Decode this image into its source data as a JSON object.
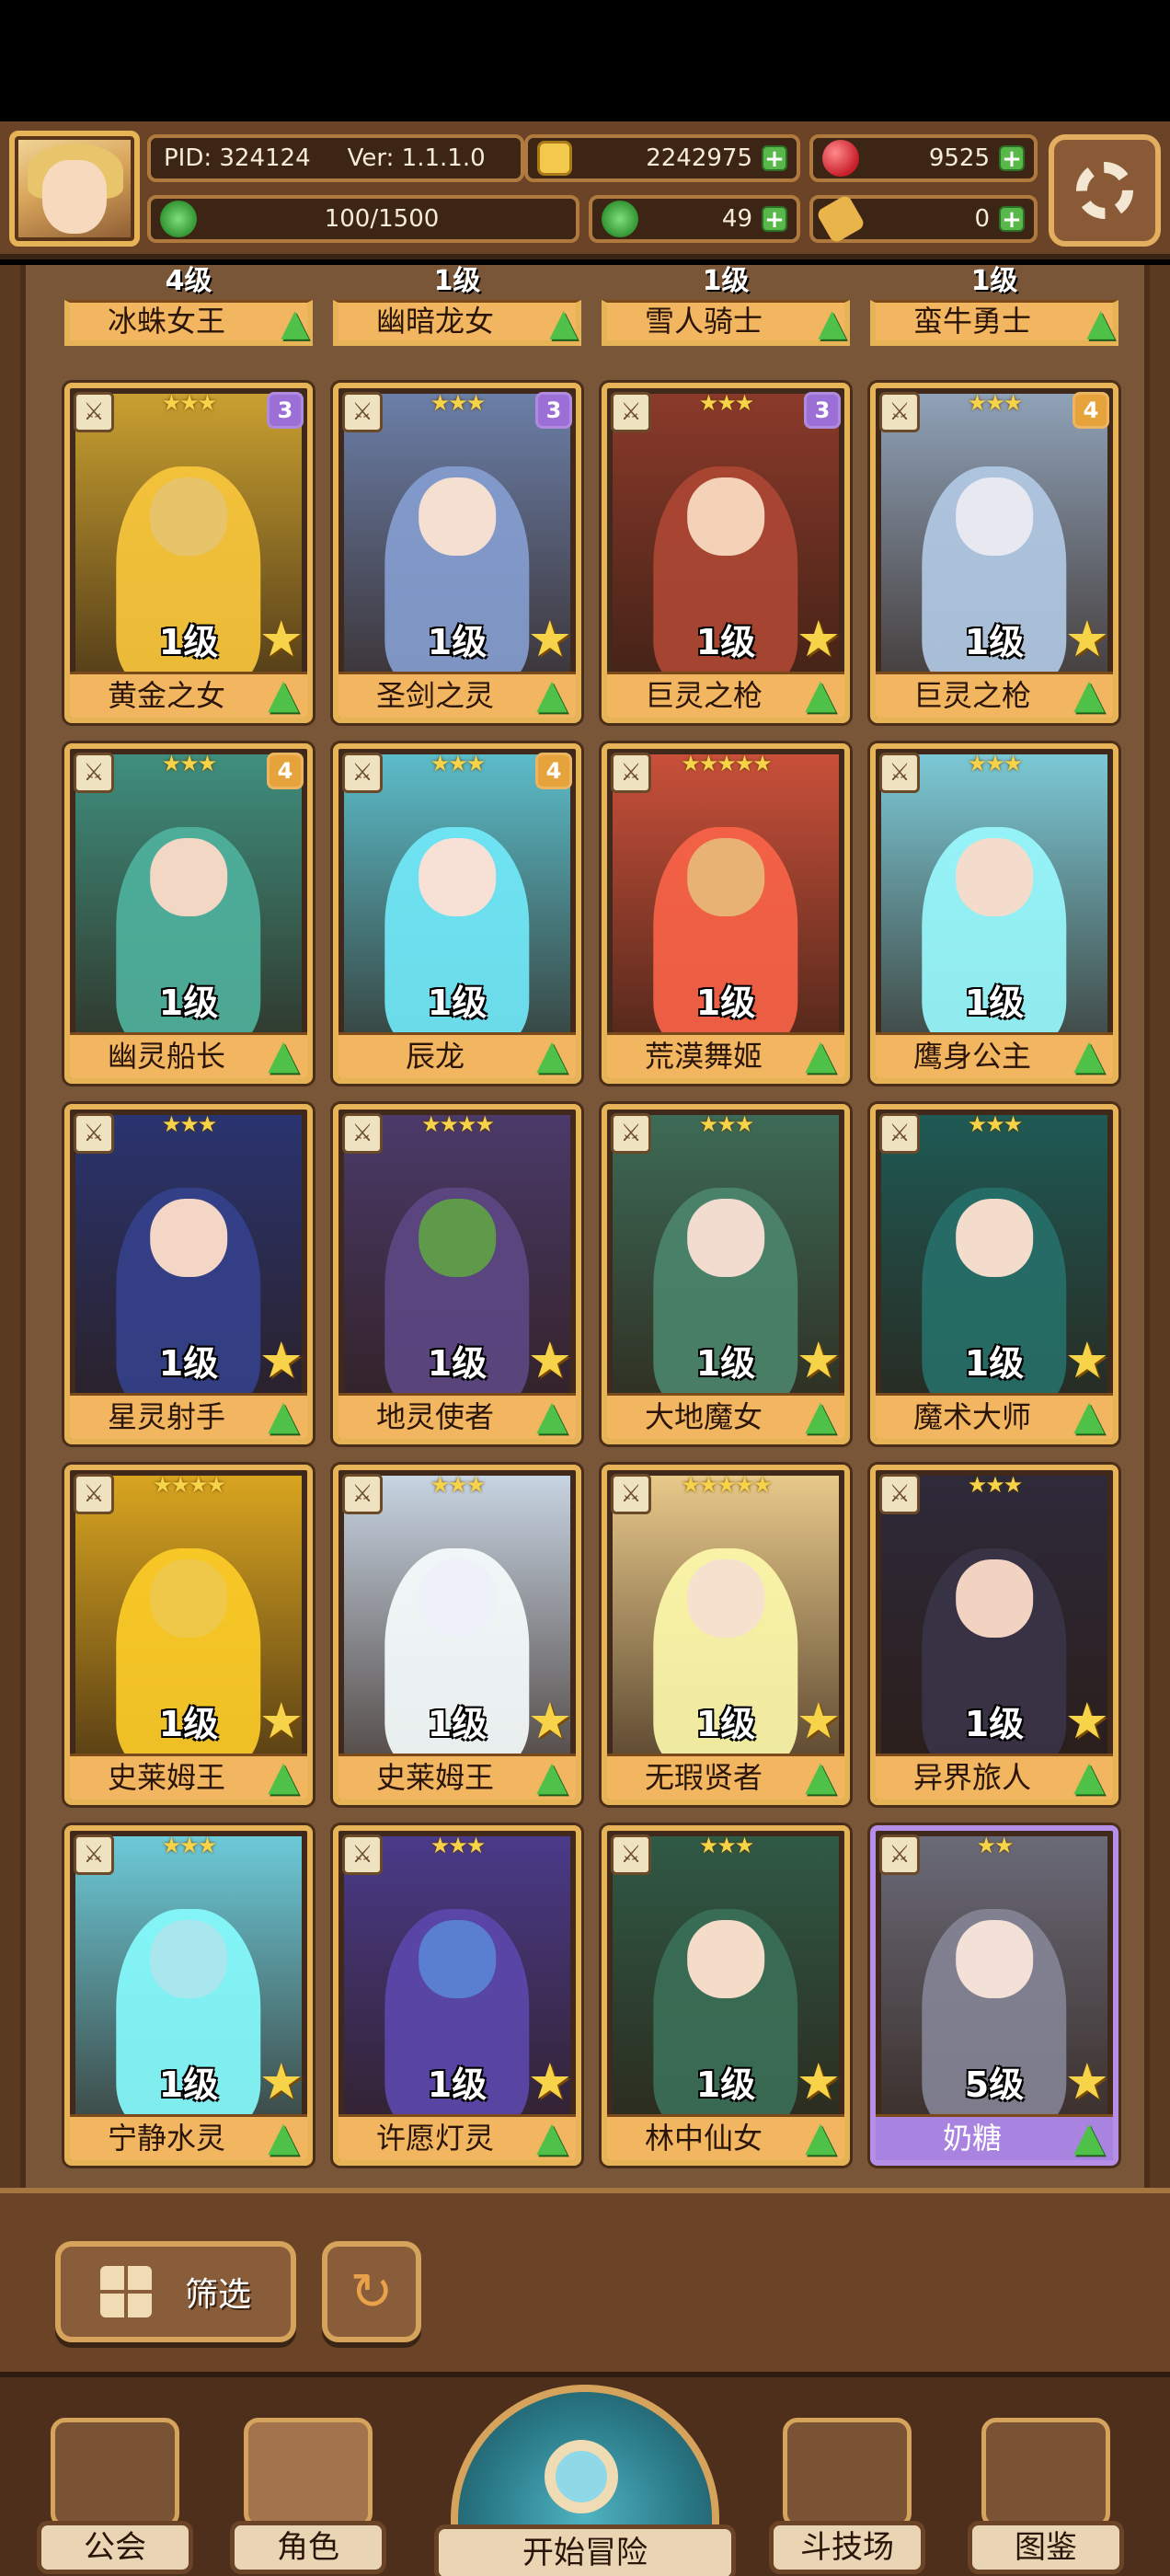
{
  "hud": {
    "pid": "PID: 324124",
    "version": "Ver: 1.1.1.0",
    "gold": "2242975",
    "gems": "9525",
    "stamina": "100/1500",
    "clover": "49",
    "scroll": "0"
  },
  "partial_row": [
    {
      "level": "4级",
      "name": "冰蛛女王"
    },
    {
      "level": "1级",
      "name": "幽暗龙女"
    },
    {
      "level": "1级",
      "name": "雪人骑士"
    },
    {
      "level": "1级",
      "name": "蛮牛勇士"
    }
  ],
  "cards": [
    {
      "name": "黄金之女",
      "level": "1级",
      "stars": "★★★",
      "badge": "3",
      "badge_color": "#9b6fd6",
      "frame": "gold",
      "art": "#c9a030",
      "face": "#e7c36a"
    },
    {
      "name": "圣剑之灵",
      "level": "1级",
      "stars": "★★★",
      "badge": "3",
      "badge_color": "#9b6fd6",
      "frame": "gold",
      "art": "#6b7fa8",
      "face": "#f4dfd1"
    },
    {
      "name": "巨灵之枪",
      "level": "1级",
      "stars": "★★★",
      "badge": "3",
      "badge_color": "#9b6fd6",
      "frame": "gold",
      "art": "#8b3a2a",
      "face": "#f3d2b8"
    },
    {
      "name": "巨灵之枪",
      "level": "1级",
      "stars": "★★★",
      "badge": "4",
      "badge_color": "#e6a33b",
      "frame": "gold",
      "art": "#8fa2b8",
      "face": "#e8e8f0"
    },
    {
      "name": "幽灵船长",
      "level": "1级",
      "stars": "★★★",
      "badge": "4",
      "badge_color": "#e6a33b",
      "frame": "gold",
      "art": "#3f8f7e",
      "face": "#f2d7c5"
    },
    {
      "name": "辰龙",
      "level": "1级",
      "stars": "★★★",
      "badge": "4",
      "badge_color": "#e6a33b",
      "frame": "gold",
      "art": "#5bbcc9",
      "face": "#f7e0d6"
    },
    {
      "name": "荒漠舞姬",
      "level": "1级",
      "stars": "★★★★★",
      "badge": "",
      "badge_color": "",
      "frame": "gold",
      "art": "#c9503a",
      "face": "#e8b274"
    },
    {
      "name": "鹰身公主",
      "level": "1级",
      "stars": "★★★",
      "badge": "",
      "badge_color": "",
      "frame": "gold",
      "art": "#7bc9d6",
      "face": "#f4dccd"
    },
    {
      "name": "星灵射手",
      "level": "1级",
      "stars": "★★★",
      "badge": "",
      "badge_color": "",
      "frame": "gold",
      "art": "#2a3470",
      "face": "#f3d6c6"
    },
    {
      "name": "地灵使者",
      "level": "1级",
      "stars": "★★★★",
      "badge": "",
      "badge_color": "",
      "frame": "gold",
      "art": "#4b3a6a",
      "face": "#5e9a4a"
    },
    {
      "name": "大地魔女",
      "level": "1级",
      "stars": "★★★",
      "badge": "",
      "badge_color": "",
      "frame": "gold",
      "art": "#3d6b57",
      "face": "#f2dcd0"
    },
    {
      "name": "魔术大师",
      "level": "1级",
      "stars": "★★★",
      "badge": "",
      "badge_color": "",
      "frame": "gold",
      "art": "#1f5a55",
      "face": "#f4dccd"
    },
    {
      "name": "史莱姆王",
      "level": "1级",
      "stars": "★★★★",
      "badge": "",
      "badge_color": "",
      "frame": "gold",
      "art": "#d9a520",
      "face": "#efc84a"
    },
    {
      "name": "史莱姆王",
      "level": "1级",
      "stars": "★★★",
      "badge": "",
      "badge_color": "",
      "frame": "gold",
      "art": "#c7d4e2",
      "face": "#eef2f8"
    },
    {
      "name": "无瑕贤者",
      "level": "1级",
      "stars": "★★★★★",
      "badge": "",
      "badge_color": "",
      "frame": "gold",
      "art": "#e8c98a",
      "face": "#f6e1cf"
    },
    {
      "name": "异界旅人",
      "level": "1级",
      "stars": "★★★",
      "badge": "",
      "badge_color": "",
      "frame": "gold",
      "art": "#2e2a3a",
      "face": "#f2d3c1"
    },
    {
      "name": "宁静水灵",
      "level": "1级",
      "stars": "★★★",
      "badge": "",
      "badge_color": "",
      "frame": "gold",
      "art": "#6ccad8",
      "face": "#a9e6ee"
    },
    {
      "name": "许愿灯灵",
      "level": "1级",
      "stars": "★★★",
      "badge": "",
      "badge_color": "",
      "frame": "gold",
      "art": "#4a3a8a",
      "face": "#5a7fd0"
    },
    {
      "name": "林中仙女",
      "level": "1级",
      "stars": "★★★",
      "badge": "",
      "badge_color": "",
      "frame": "gold",
      "art": "#2f5a46",
      "face": "#f5dcc8"
    },
    {
      "name": "奶糖",
      "level": "5级",
      "stars": "★★",
      "badge": "",
      "badge_color": "",
      "frame": "purple",
      "art": "#6a6a78",
      "face": "#f3e1d8"
    }
  ],
  "toolbar": {
    "filter_label": "筛选",
    "refresh_symbol": "↻"
  },
  "nav": {
    "guild": "公会",
    "characters": "角色",
    "adventure": "开始冒险",
    "arena": "斗技场",
    "codex": "图鉴"
  },
  "icons": {
    "settings": "gear-icon",
    "filter": "grid-icon",
    "refresh": "refresh-icon",
    "level_up": "green-arrow-up-icon",
    "star": "star-icon"
  }
}
